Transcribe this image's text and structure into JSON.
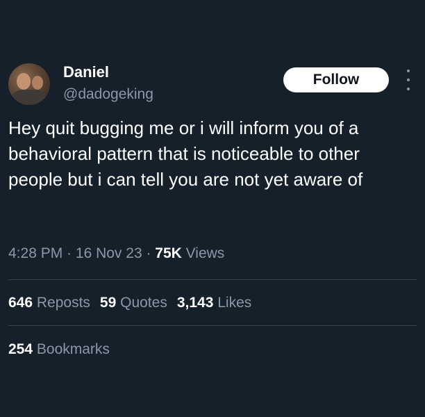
{
  "user": {
    "name": "Daniel",
    "handle": "@dadogeking"
  },
  "follow_label": "Follow",
  "tweet": {
    "text": "Hey quit bugging me or i will inform you of a behavioral pattern that is noticeable to other people but i can tell you are not yet aware of"
  },
  "meta": {
    "time": "4:28 PM",
    "sep1": " · ",
    "date": "16 Nov 23",
    "sep2": " · ",
    "views_count": "75K",
    "views_label": " Views"
  },
  "stats": {
    "reposts_count": "646",
    "reposts_label": " Reposts",
    "quotes_count": "59",
    "quotes_label": " Quotes",
    "likes_count": "3,143",
    "likes_label": " Likes",
    "bookmarks_count": "254",
    "bookmarks_label": " Bookmarks"
  },
  "icons": {
    "more": "more-horizontal-icon"
  },
  "colors": {
    "background": "#15202b",
    "secondary_text": "#8b98a5",
    "divider": "#38444d",
    "follow_bg": "#ffffff"
  }
}
